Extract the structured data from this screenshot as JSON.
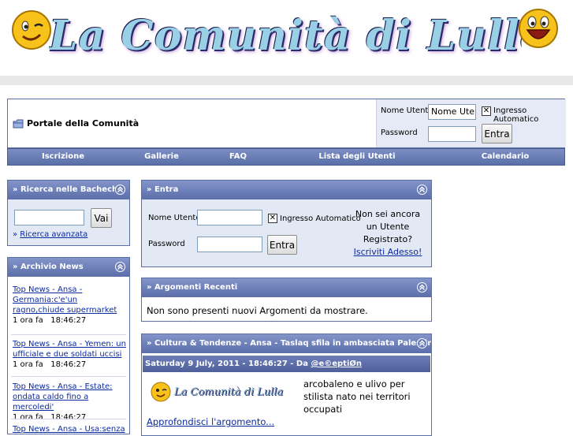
{
  "banner": {
    "title": "La Comunità di Lulla"
  },
  "header": {
    "portal_label": "Portale della Comunità",
    "login": {
      "username_label": "Nome Utente",
      "username_value": "Nome Utente",
      "auto_login_label": "Ingresso Automatico",
      "password_label": "Password",
      "submit_label": "Entra"
    }
  },
  "nav": {
    "items": [
      "Iscrizione",
      "Gallerie",
      "FAQ",
      "Lista degli Utenti",
      "Calendario"
    ]
  },
  "search_panel": {
    "title": "» Ricerca nelle Bacheche",
    "button": "Vai",
    "advanced_prefix": "» ",
    "advanced_link": "Ricerca avanzata"
  },
  "archive_panel": {
    "title": "» Archivio News",
    "items": [
      {
        "title": "Top News - Ansa - Germania:c'e'un ragno,chiude supermarket",
        "time_ago": "1 ora fa",
        "time": "18:46:27"
      },
      {
        "title": "Top News - Ansa - Yemen: un ufficiale e due soldati uccisi",
        "time_ago": "1 ora fa",
        "time": "18:46:27"
      },
      {
        "title": "Top News - Ansa - Estate: ondata caldo fino a mercoledi'",
        "time_ago": "1 ora fa",
        "time": "18:46:27"
      },
      {
        "title": "Top News - Ansa - Usa:senza"
      }
    ]
  },
  "login_panel": {
    "title": "» Entra",
    "username_label": "Nome Utente",
    "password_label": "Password",
    "auto_login_label": "Ingresso Automatico",
    "submit_label": "Entra",
    "not_registered": "Non sei ancora un Utente Registrato?",
    "register_link": "Iscriviti Adesso!"
  },
  "recent_panel": {
    "title": "» Argomenti Recenti",
    "empty_message": "Non sono presenti nuovi Argomenti da mostrare."
  },
  "article_panel": {
    "title": "» Cultura & Tendenze - Ansa - Taslaq sfila in ambasciata Palestina",
    "meta_date": "Saturday 9 July, 2011 - 18:46:27 - Da ",
    "meta_author": "@e©eptiØn",
    "logo_text": "La Comunità di Lulla",
    "body": "arcobaleno e ulivo per stilista nato nei territori occupati",
    "read_more": "Approfondisci l'argomento..."
  },
  "colors": {
    "header_gradient_top": "#8394c9",
    "header_gradient_bottom": "#5b6ea9",
    "link": "#0a2aa0",
    "panel_border": "#5a6fa5",
    "panel_blue_bg": "#e3e8f5"
  }
}
